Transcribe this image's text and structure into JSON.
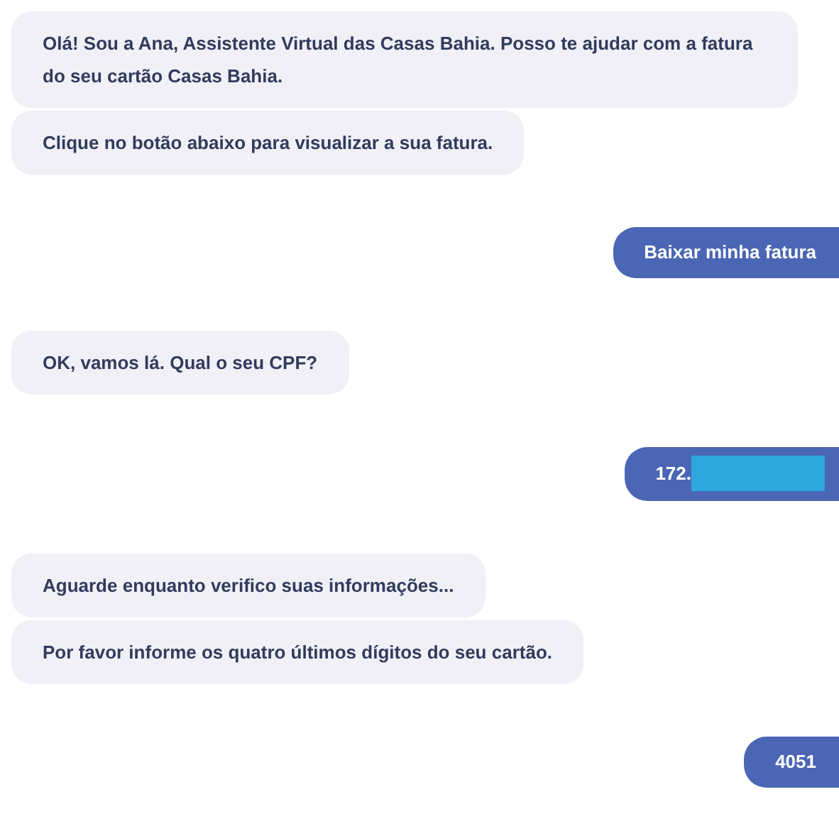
{
  "messages": [
    {
      "kind": "bot",
      "texts": [
        "Olá! Sou a Ana, Assistente Virtual das Casas Bahia. Posso te ajudar com a fatura do seu cartão Casas Bahia.",
        "Clique no botão abaixo para visualizar a sua fatura."
      ]
    },
    {
      "kind": "user",
      "texts": [
        "Baixar minha fatura"
      ],
      "redacted": false
    },
    {
      "kind": "bot",
      "texts": [
        "OK, vamos lá. Qual o seu CPF?"
      ]
    },
    {
      "kind": "user",
      "texts": [
        "172."
      ],
      "redacted": true
    },
    {
      "kind": "bot",
      "texts": [
        "Aguarde enquanto verifico suas informações...",
        "Por favor informe os quatro últimos dígitos do seu cartão."
      ]
    },
    {
      "kind": "user",
      "texts": [
        "4051"
      ],
      "redacted": false
    }
  ]
}
